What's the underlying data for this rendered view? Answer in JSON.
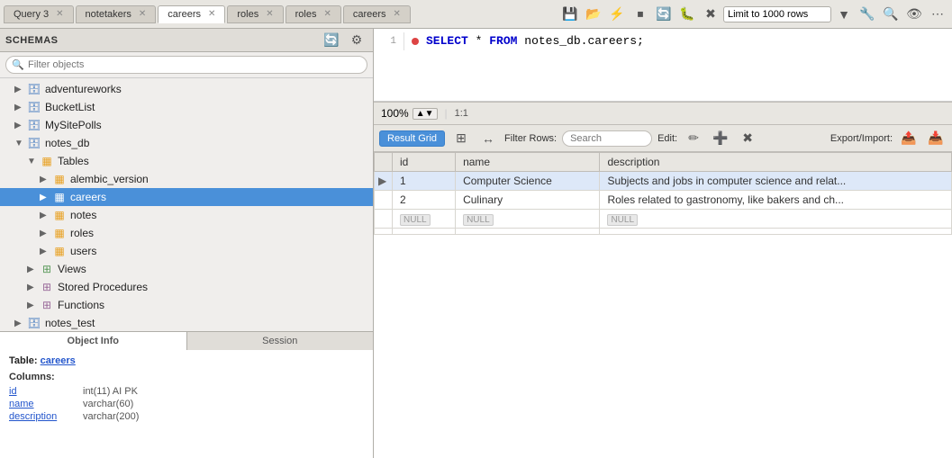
{
  "tabs": [
    {
      "id": "query3",
      "label": "Query 3",
      "active": false
    },
    {
      "id": "notetakers",
      "label": "notetakers",
      "active": false
    },
    {
      "id": "careers",
      "label": "careers",
      "active": true
    },
    {
      "id": "roles",
      "label": "roles",
      "active": false
    },
    {
      "id": "roles2",
      "label": "roles",
      "active": false
    },
    {
      "id": "careers2",
      "label": "careers",
      "active": false
    }
  ],
  "toolbar": {
    "limit_label": "Limit to 1000 rows",
    "limit_value": "Limit to 1000 rows"
  },
  "sidebar": {
    "title": "SCHEMAS",
    "filter_placeholder": "Filter objects",
    "items": [
      {
        "id": "adventureworks",
        "label": "adventureworks",
        "level": 1,
        "type": "db",
        "expanded": false
      },
      {
        "id": "bucketlist",
        "label": "BucketList",
        "level": 1,
        "type": "db",
        "expanded": false
      },
      {
        "id": "mysitepolls",
        "label": "MySitePolls",
        "level": 1,
        "type": "db",
        "expanded": false
      },
      {
        "id": "notes_db",
        "label": "notes_db",
        "level": 1,
        "type": "db",
        "expanded": true
      },
      {
        "id": "tables",
        "label": "Tables",
        "level": 2,
        "type": "folder",
        "expanded": true
      },
      {
        "id": "alembic_version",
        "label": "alembic_version",
        "level": 3,
        "type": "table",
        "expanded": false
      },
      {
        "id": "careers",
        "label": "careers",
        "level": 3,
        "type": "table",
        "expanded": false,
        "selected": true
      },
      {
        "id": "notes",
        "label": "notes",
        "level": 3,
        "type": "table",
        "expanded": false
      },
      {
        "id": "roles",
        "label": "roles",
        "level": 3,
        "type": "table",
        "expanded": false
      },
      {
        "id": "users",
        "label": "users",
        "level": 3,
        "type": "table",
        "expanded": false
      },
      {
        "id": "views",
        "label": "Views",
        "level": 2,
        "type": "folder",
        "expanded": false
      },
      {
        "id": "stored_procedures",
        "label": "Stored Procedures",
        "level": 2,
        "type": "folder",
        "expanded": false
      },
      {
        "id": "functions",
        "label": "Functions",
        "level": 2,
        "type": "folder",
        "expanded": false
      },
      {
        "id": "notes_test",
        "label": "notes_test",
        "level": 1,
        "type": "db",
        "expanded": false
      }
    ]
  },
  "sidebar_tabs": [
    {
      "id": "object_info",
      "label": "Object Info",
      "active": true
    },
    {
      "id": "session",
      "label": "Session",
      "active": false
    }
  ],
  "object_info": {
    "table_label": "Table:",
    "table_name": "careers",
    "columns_label": "Columns:",
    "columns": [
      {
        "name": "id",
        "type": "int(11) AI PK"
      },
      {
        "name": "name",
        "type": "varchar(60)"
      },
      {
        "name": "description",
        "type": "varchar(200)"
      }
    ]
  },
  "editor": {
    "zoom": "100%",
    "position": "1:1",
    "sql_line": "SELECT * FROM notes_db.careers;"
  },
  "results": {
    "tab_label": "Result Grid",
    "filter_label": "Filter Rows:",
    "filter_placeholder": "Search",
    "edit_label": "Edit:",
    "export_label": "Export/Import:",
    "columns": [
      "id",
      "name",
      "description"
    ],
    "rows": [
      {
        "arrow": true,
        "selected": true,
        "id": "1",
        "name": "Computer Science",
        "description": "Subjects and jobs in computer science and relat..."
      },
      {
        "arrow": false,
        "selected": false,
        "id": "2",
        "name": "Culinary",
        "description": "Roles related to gastronomy, like bakers and ch..."
      }
    ],
    "empty_rows": [
      "",
      ""
    ]
  }
}
